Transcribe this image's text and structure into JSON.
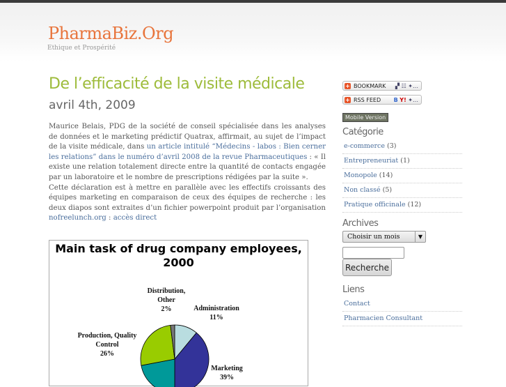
{
  "header": {
    "site_title": "PharmaBiz.Org",
    "tagline": "Ethique et Prospérité"
  },
  "post": {
    "title": "De l’efficacité de la visite médicale",
    "date": "avril 4th, 2009",
    "p1_a": "Maurice Belais, PDG de la société de conseil spécialisée dans les analyses de données et le marketing prédictif Quatrax, affirmait, au sujet de l’impact de la visite médicale, dans ",
    "p1_link": "un article intitulé “Médecins - labos : Bien cerner les relations” dans le numéro d’avril 2008 de la revue Pharmaceutiques",
    "p1_b": " : « Il existe une relation totalement directe entre la quantité de contacts engagée par un laboratoire et le nombre de prescriptions rédigées par la suite ».",
    "p2_a": "Cette déclaration est à mettre en parallèle avec les effectifs croissants des équipes marketing en comparaison de ceux des équipes de recherche : les deux diapos sont extraites d’un fichier powerpoint produit par l’organisation ",
    "p2_link1": "nofreelunch.org",
    "p2_sep": " : ",
    "p2_link2": "accès direct"
  },
  "chart_data": {
    "type": "pie",
    "title": "Main task of drug company employees, 2000",
    "slices": [
      {
        "label": "Administration",
        "pct_label": "11%",
        "value": 11,
        "color": "#b9dde0"
      },
      {
        "label": "Marketing",
        "pct_label": "39%",
        "value": 39,
        "color": "#333399"
      },
      {
        "label": "",
        "pct_label": "",
        "value": 22,
        "color": "#009999"
      },
      {
        "label": "Production, Quality Control",
        "pct_label": "26%",
        "value": 26,
        "color": "#99cc00"
      },
      {
        "label": "Distribution, Other",
        "pct_label": "2%",
        "value": 2,
        "color": "#777777"
      }
    ]
  },
  "sidebar": {
    "bookmark": "BOOKMARK",
    "rss": "RSS FEED",
    "mobile": "Mobile Version",
    "categories_title": "Catégorie",
    "categories": [
      {
        "name": "e-commerce",
        "count": "(3)"
      },
      {
        "name": "Entrepreneuriat",
        "count": "(1)"
      },
      {
        "name": "Monopole",
        "count": "(14)"
      },
      {
        "name": "Non classé",
        "count": "(5)"
      },
      {
        "name": "Pratique officinale",
        "count": "(12)"
      }
    ],
    "archives_title": "Archives",
    "archive_select": "Choisir un mois",
    "search_button": "Recherche",
    "links_title": "Liens",
    "links": [
      "Contact",
      "Pharmacien Consultant"
    ]
  }
}
